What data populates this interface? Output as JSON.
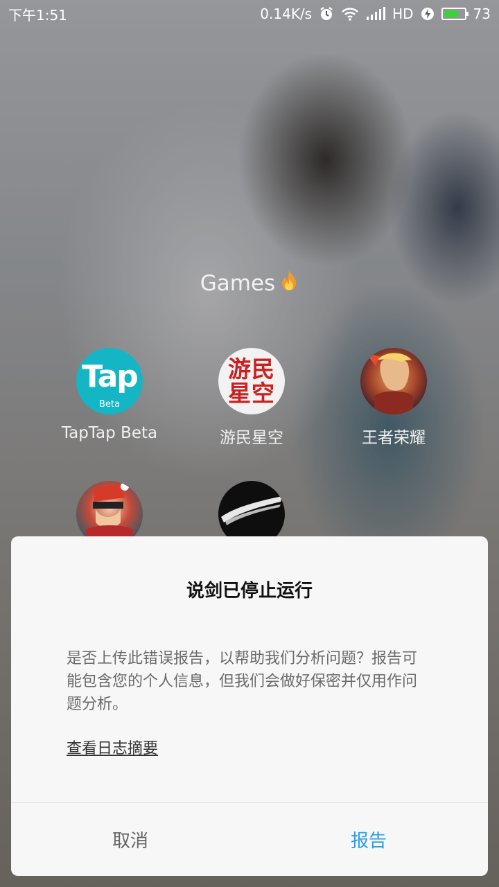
{
  "status_bar": {
    "time": "下午1:51",
    "net_speed": "0.14K/s",
    "network_type": "HD",
    "battery": "73",
    "battery_level": 0.73,
    "battery_color": "#3ad13a"
  },
  "folder": {
    "title": "Games",
    "title_icon": "flame-icon",
    "apps": [
      {
        "label": "TapTap Beta",
        "icon_text": "Tap",
        "icon_sub": "Beta"
      },
      {
        "label": "游民星空",
        "icon_text": [
          "游",
          "民",
          "星",
          "空"
        ]
      },
      {
        "label": "王者荣耀"
      },
      {
        "label": ""
      },
      {
        "label": ""
      }
    ]
  },
  "dialog": {
    "title": "说剑已停止运行",
    "message": "是否上传此错误报告，以帮助我们分析问题？报告可能包含您的个人信息，但我们会做好保密并仅用作问题分析。",
    "link": "查看日志摘要",
    "cancel_label": "取消",
    "report_label": "报告",
    "accent_color": "#2a9ee8"
  }
}
